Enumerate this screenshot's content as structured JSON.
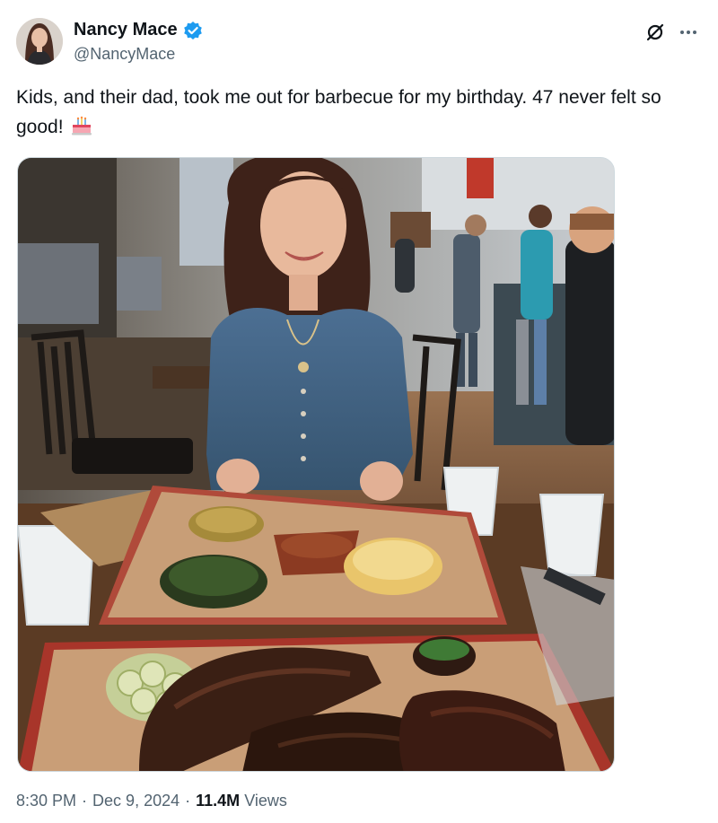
{
  "author": {
    "display_name": "Nancy Mace",
    "handle": "@NancyMace",
    "verified": true,
    "verified_color": "#1d9bf0"
  },
  "icons": {
    "grok": "grok-icon",
    "more": "more-options-icon",
    "emoji": "birthday-cake-emoji"
  },
  "tweet": {
    "text": "Kids, and their dad, took me out for barbecue for my birthday. 47 never felt so good!"
  },
  "meta": {
    "time": "8:30 PM",
    "date": "Dec 9, 2024",
    "views_count": "11.4M",
    "views_label": "Views",
    "separator": "·"
  }
}
